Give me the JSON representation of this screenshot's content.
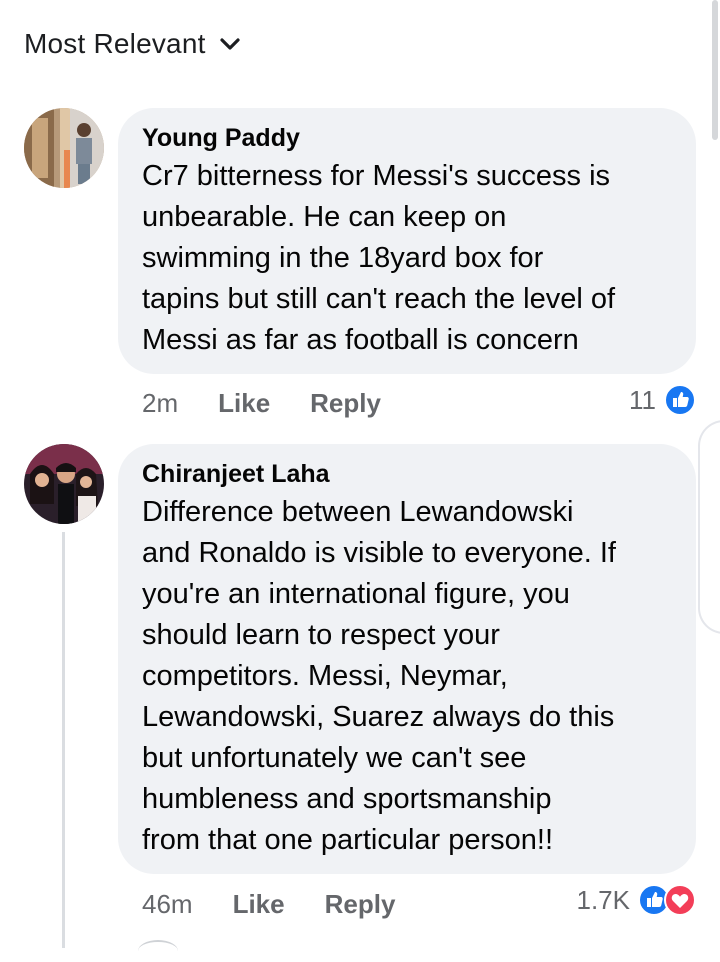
{
  "sort": {
    "label": "Most Relevant"
  },
  "comments": [
    {
      "author": "Young Paddy",
      "text": "Cr7 bitterness for Messi's success is\nunbearable. He can keep on\nswimming in the 18yard box for\ntapins but still can't reach the level of\nMessi as far as football is concern",
      "time": "2m",
      "like_label": "Like",
      "reply_label": "Reply",
      "reaction_count": "11",
      "reactions": [
        "like-icon"
      ]
    },
    {
      "author": "Chiranjeet Laha",
      "text": "Difference between Lewandowski\nand Ronaldo is visible to everyone. If\nyou're an international figure, you\nshould learn to respect your\ncompetitors. Messi, Neymar,\nLewandowski, Suarez always do this\nbut unfortunately we can't see\nhumbleness and sportsmanship\nfrom that one particular person!!",
      "time": "46m",
      "like_label": "Like",
      "reply_label": "Reply",
      "reaction_count": "1.7K",
      "reactions": [
        "like-icon",
        "love-icon"
      ]
    }
  ],
  "colors": {
    "like_blue": "#1877f2",
    "love_red": "#f33e58",
    "bubble_bg": "#f0f2f5",
    "meta_gray": "#65676b"
  }
}
